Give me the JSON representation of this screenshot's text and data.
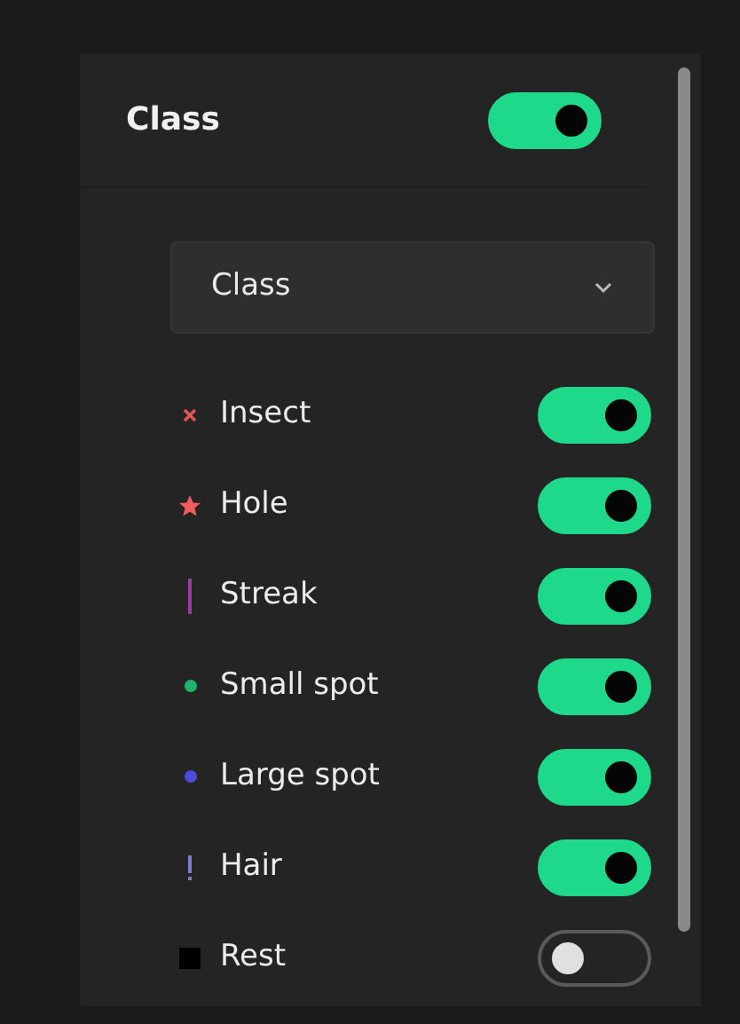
{
  "header": {
    "title": "Class",
    "on": true
  },
  "dropdown": {
    "value": "Class"
  },
  "classes": [
    {
      "label": "Insect",
      "kind": "cross",
      "color": "#e05555",
      "on": true
    },
    {
      "label": "Hole",
      "kind": "star",
      "color": "#f25c5c",
      "on": true
    },
    {
      "label": "Streak",
      "kind": "bar",
      "color": "#9b3aa0",
      "on": true
    },
    {
      "label": "Small spot",
      "kind": "dot",
      "color": "#1db36b",
      "on": true
    },
    {
      "label": "Large spot",
      "kind": "dot",
      "color": "#4b4bdc",
      "on": true
    },
    {
      "label": "Hair",
      "kind": "exclaim",
      "color": "#7c7cd0",
      "on": true
    },
    {
      "label": "Rest",
      "kind": "square",
      "color": "#000000",
      "on": false
    }
  ]
}
